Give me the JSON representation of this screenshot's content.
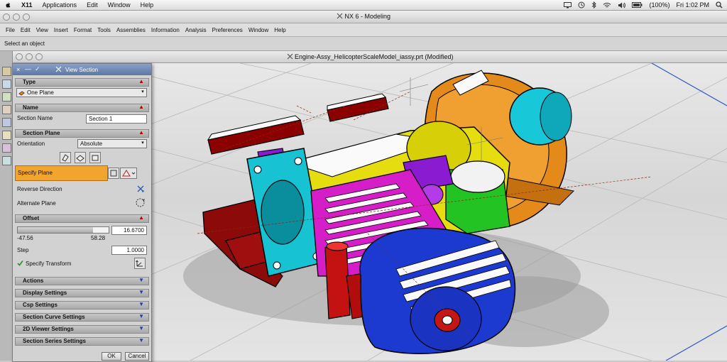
{
  "mac_menubar": {
    "items": [
      "X11",
      "Applications",
      "Edit",
      "Window",
      "Help"
    ],
    "battery": "(100%)",
    "clock": "Fri 1:02 PM"
  },
  "app_window": {
    "title": "NX 6 - Modeling",
    "menu": [
      "File",
      "Edit",
      "View",
      "Insert",
      "Format",
      "Tools",
      "Assemblies",
      "Information",
      "Analysis",
      "Preferences",
      "Window",
      "Help"
    ],
    "status": "Select an object"
  },
  "viewport": {
    "title": "Engine-Assy_HelicopterScaleModel_iassy.prt (Modified)"
  },
  "dialog": {
    "title": "View Section",
    "type_section": "Type",
    "type_value": "One Plane",
    "name_section": "Name",
    "section_name_label": "Section Name",
    "section_name_value": "Section 1",
    "plane_section": "Section Plane",
    "orientation_label": "Orientation",
    "orientation_value": "Absolute",
    "specify_plane": "Specify Plane",
    "reverse_direction": "Reverse Direction",
    "alternate_plane": "Alternate Plane",
    "offset_section": "Offset",
    "offset_value": "16.6700",
    "offset_slider_fraction": 0.83,
    "offset_min": "-47.56",
    "offset_max": "58.28",
    "step_label": "Step",
    "step_value": "1.0000",
    "specify_transform": "Specify Transform",
    "collapsed_sections": [
      "Actions",
      "Display Settings",
      "Csp Settings",
      "Section Curve Settings",
      "2D Viewer Settings",
      "Section Series Settings"
    ],
    "ok_label": "OK",
    "cancel_label": "Cancel"
  }
}
